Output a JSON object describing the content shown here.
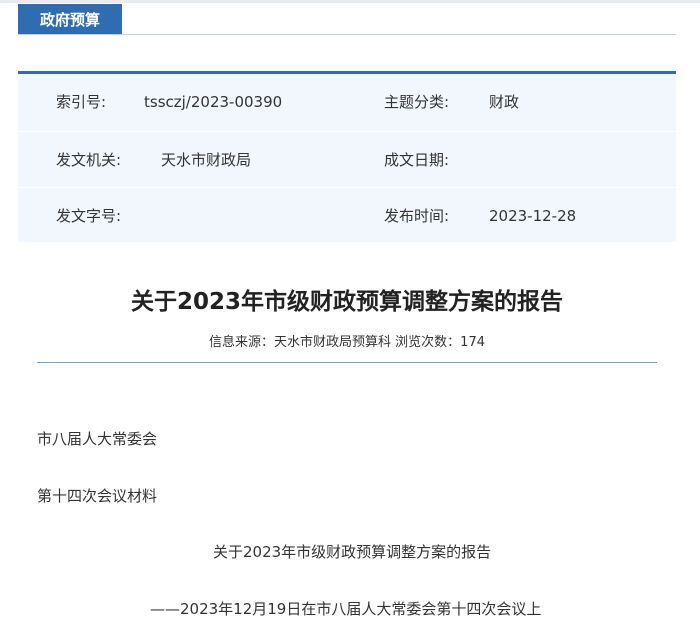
{
  "section": {
    "tab_label": "政府预算"
  },
  "meta": {
    "index_label": "索引号:",
    "index_value": "tssczj/2023-00390",
    "topic_label": "主题分类:",
    "topic_value": "财政",
    "issuer_label": "发文机关:",
    "issuer_value": "天水市财政局",
    "written_label": "成文日期:",
    "written_value": "",
    "docno_label": "发文字号:",
    "docno_value": "",
    "published_label": "发布时间:",
    "published_value": "2023-12-28"
  },
  "article": {
    "title": "关于2023年市级财政预算调整方案的报告",
    "source_label": "信息来源：",
    "source_value": "天水市财政局预算科",
    "views_label": "浏览次数：",
    "views_value": "174",
    "para1": "市八届人大常委会",
    "para2": "第十四次会议材料",
    "subtitle": "关于2023年市级财政预算调整方案的报告",
    "subtitle2": "——2023年12月19日在市八届人大常委会第十四次会议上"
  },
  "colors": {
    "accent": "#2f6db0",
    "meta_bg": "#f1f7fd",
    "divider": "#6fa3d6"
  }
}
